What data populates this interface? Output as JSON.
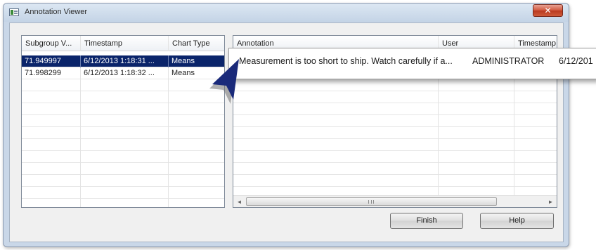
{
  "window": {
    "title": "Annotation Viewer",
    "close_glyph": "✕"
  },
  "left_grid": {
    "columns": [
      "Subgroup V...",
      "Timestamp",
      "Chart Type"
    ],
    "rows": [
      {
        "value": "71.949997",
        "timestamp": "6/12/2013 1:18:31 ...",
        "chart_type": "Means",
        "selected": true
      },
      {
        "value": "71.998299",
        "timestamp": "6/12/2013 1:18:32 ...",
        "chart_type": "Means",
        "selected": false
      }
    ]
  },
  "right_grid": {
    "columns": [
      "Annotation",
      "User",
      "Timestamp"
    ],
    "callout_row": {
      "annotation": "Measurement is too short to ship. Watch carefully if a...",
      "user": "ADMINISTRATOR",
      "timestamp": "6/12/201"
    },
    "scrollbar": {
      "left_arrow": "◄",
      "right_arrow": "►"
    }
  },
  "buttons": {
    "finish": "Finish",
    "help": "Help"
  },
  "colors": {
    "selection": "#0a246a",
    "pointer_arrow": "#1a2a7a",
    "close_button": "#c8472b"
  },
  "icons": [
    "app-icon",
    "close-icon",
    "pointer-arrow-icon",
    "scroll-left-icon",
    "scroll-right-icon",
    "scroll-grip-icon"
  ]
}
